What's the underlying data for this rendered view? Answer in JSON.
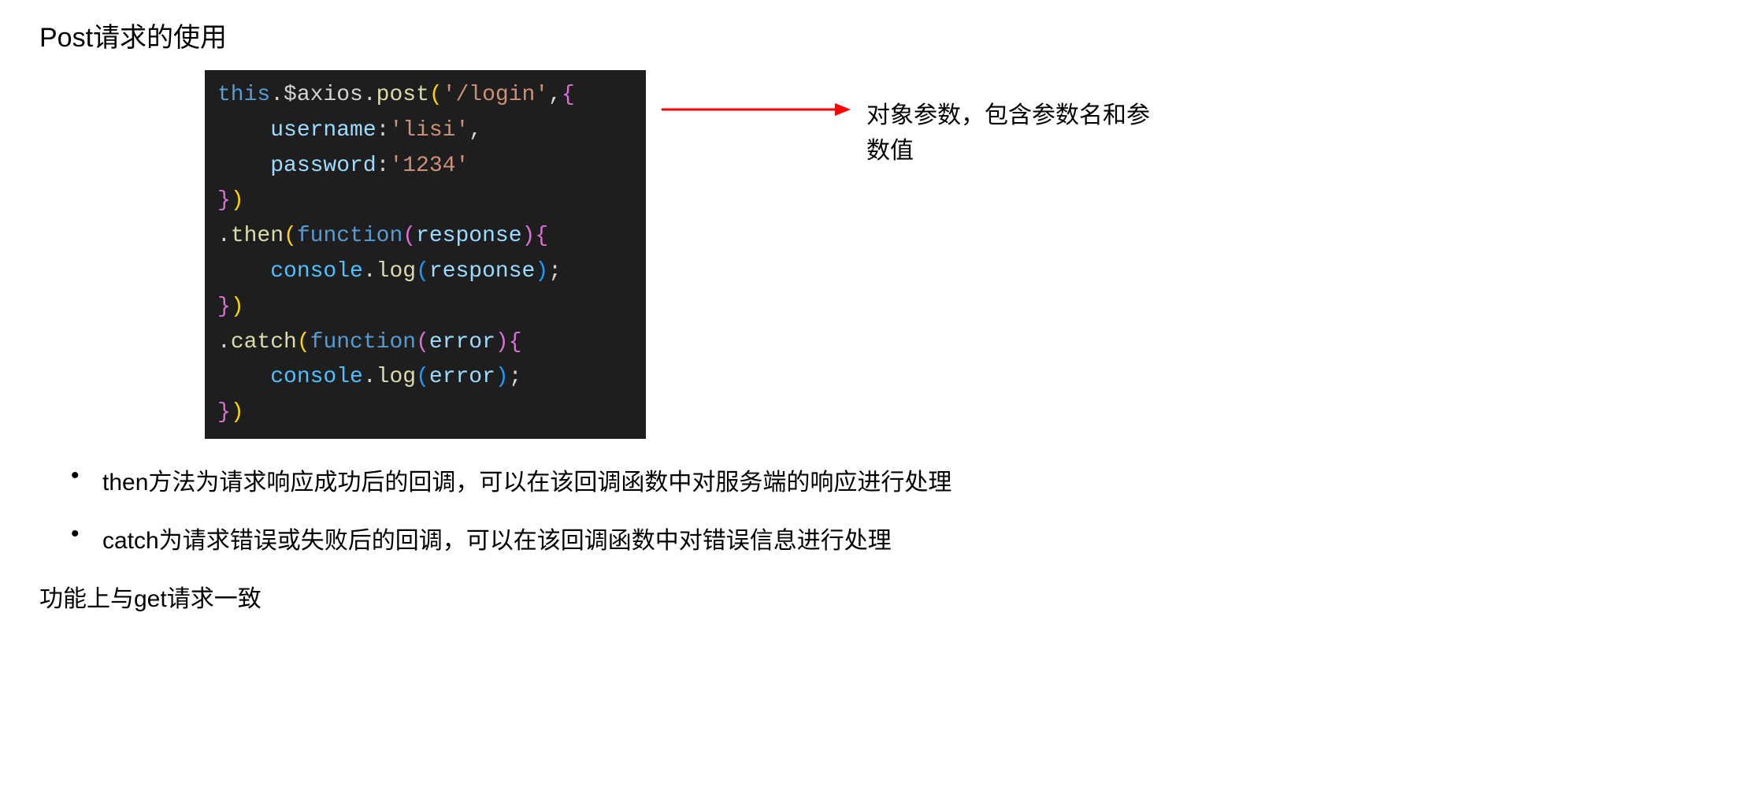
{
  "heading": "Post请求的使用",
  "code": {
    "line1": {
      "this": "this",
      "dot1": ".",
      "axios": "$axios",
      "dot2": ".",
      "post": "post",
      "open": "(",
      "url": "'/login'",
      "comma": ",",
      "brace": "{"
    },
    "line2": {
      "indent": "    ",
      "prop": "username",
      "colon": ":",
      "val": "'lisi'",
      "comma": ","
    },
    "line3": {
      "indent": "    ",
      "prop": "password",
      "colon": ":",
      "val": "'1234'"
    },
    "line4": {
      "close": "})"
    },
    "line5": {
      "dot": ".",
      "then": "then",
      "open": "(",
      "func": "function",
      "popen": "(",
      "param": "response",
      "pclose": ")",
      "brace": "{"
    },
    "line6": {
      "indent": "    ",
      "console": "console",
      "dot": ".",
      "log": "log",
      "open": "(",
      "param": "response",
      "close": ")",
      "semi": ";"
    },
    "line7": {
      "close": "})"
    },
    "line8": {
      "dot": ".",
      "catch": "catch",
      "open": "(",
      "func": "function",
      "popen": "(",
      "param": "error",
      "pclose": ")",
      "brace": "{"
    },
    "line9": {
      "indent": "    ",
      "console": "console",
      "dot": ".",
      "log": "log",
      "open": "(",
      "param": "error",
      "close": ")",
      "semi": ";"
    },
    "line10": {
      "close": "})"
    }
  },
  "annotation": "对象参数，包含参数名和参数值",
  "bullets": [
    "then方法为请求响应成功后的回调，可以在该回调函数中对服务端的响应进行处理",
    "catch为请求错误或失败后的回调，可以在该回调函数中对错误信息进行处理"
  ],
  "footer": "功能上与get请求一致"
}
